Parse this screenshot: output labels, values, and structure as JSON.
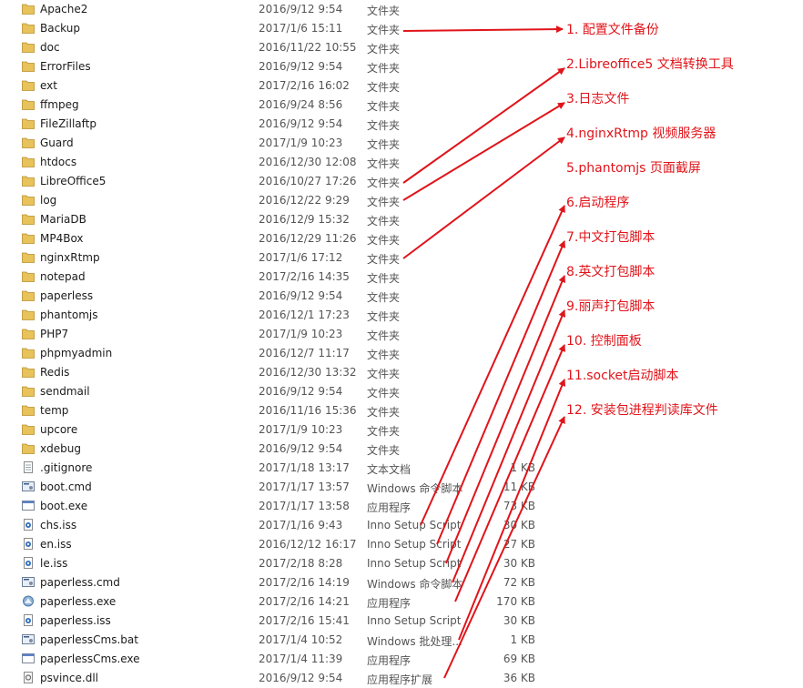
{
  "files": [
    {
      "name": "Apache2",
      "date": "2016/9/12 9:54",
      "type": "文件夹",
      "size": "",
      "kind": "folder"
    },
    {
      "name": "Backup",
      "date": "2017/1/6 15:11",
      "type": "文件夹",
      "size": "",
      "kind": "folder"
    },
    {
      "name": "doc",
      "date": "2016/11/22 10:55",
      "type": "文件夹",
      "size": "",
      "kind": "folder"
    },
    {
      "name": "ErrorFiles",
      "date": "2016/9/12 9:54",
      "type": "文件夹",
      "size": "",
      "kind": "folder"
    },
    {
      "name": "ext",
      "date": "2017/2/16 16:02",
      "type": "文件夹",
      "size": "",
      "kind": "folder"
    },
    {
      "name": "ffmpeg",
      "date": "2016/9/24 8:56",
      "type": "文件夹",
      "size": "",
      "kind": "folder"
    },
    {
      "name": "FileZillaftp",
      "date": "2016/9/12 9:54",
      "type": "文件夹",
      "size": "",
      "kind": "folder"
    },
    {
      "name": "Guard",
      "date": "2017/1/9 10:23",
      "type": "文件夹",
      "size": "",
      "kind": "folder"
    },
    {
      "name": "htdocs",
      "date": "2016/12/30 12:08",
      "type": "文件夹",
      "size": "",
      "kind": "folder"
    },
    {
      "name": "LibreOffice5",
      "date": "2016/10/27 17:26",
      "type": "文件夹",
      "size": "",
      "kind": "folder"
    },
    {
      "name": "log",
      "date": "2016/12/22 9:29",
      "type": "文件夹",
      "size": "",
      "kind": "folder"
    },
    {
      "name": "MariaDB",
      "date": "2016/12/9 15:32",
      "type": "文件夹",
      "size": "",
      "kind": "folder"
    },
    {
      "name": "MP4Box",
      "date": "2016/12/29 11:26",
      "type": "文件夹",
      "size": "",
      "kind": "folder"
    },
    {
      "name": "nginxRtmp",
      "date": "2017/1/6 17:12",
      "type": "文件夹",
      "size": "",
      "kind": "folder"
    },
    {
      "name": "notepad",
      "date": "2017/2/16 14:35",
      "type": "文件夹",
      "size": "",
      "kind": "folder"
    },
    {
      "name": "paperless",
      "date": "2016/9/12 9:54",
      "type": "文件夹",
      "size": "",
      "kind": "folder"
    },
    {
      "name": "phantomjs",
      "date": "2016/12/1 17:23",
      "type": "文件夹",
      "size": "",
      "kind": "folder"
    },
    {
      "name": "PHP7",
      "date": "2017/1/9 10:23",
      "type": "文件夹",
      "size": "",
      "kind": "folder"
    },
    {
      "name": "phpmyadmin",
      "date": "2016/12/7 11:17",
      "type": "文件夹",
      "size": "",
      "kind": "folder"
    },
    {
      "name": "Redis",
      "date": "2016/12/30 13:32",
      "type": "文件夹",
      "size": "",
      "kind": "folder"
    },
    {
      "name": "sendmail",
      "date": "2016/9/12 9:54",
      "type": "文件夹",
      "size": "",
      "kind": "folder"
    },
    {
      "name": "temp",
      "date": "2016/11/16 15:36",
      "type": "文件夹",
      "size": "",
      "kind": "folder"
    },
    {
      "name": "upcore",
      "date": "2017/1/9 10:23",
      "type": "文件夹",
      "size": "",
      "kind": "folder"
    },
    {
      "name": "xdebug",
      "date": "2016/9/12 9:54",
      "type": "文件夹",
      "size": "",
      "kind": "folder"
    },
    {
      "name": ".gitignore",
      "date": "2017/1/18 13:17",
      "type": "文本文档",
      "size": "1 KB",
      "kind": "text"
    },
    {
      "name": "boot.cmd",
      "date": "2017/1/17 13:57",
      "type": "Windows 命令脚本",
      "size": "11 KB",
      "kind": "cmd"
    },
    {
      "name": "boot.exe",
      "date": "2017/1/17 13:58",
      "type": "应用程序",
      "size": "73 KB",
      "kind": "exe"
    },
    {
      "name": "chs.iss",
      "date": "2017/1/16 9:43",
      "type": "Inno Setup Script",
      "size": "30 KB",
      "kind": "iss"
    },
    {
      "name": "en.iss",
      "date": "2016/12/12 16:17",
      "type": "Inno Setup Script",
      "size": "27 KB",
      "kind": "iss"
    },
    {
      "name": "le.iss",
      "date": "2017/2/18 8:28",
      "type": "Inno Setup Script",
      "size": "30 KB",
      "kind": "iss"
    },
    {
      "name": "paperless.cmd",
      "date": "2017/2/16 14:19",
      "type": "Windows 命令脚本",
      "size": "72 KB",
      "kind": "cmd"
    },
    {
      "name": "paperless.exe",
      "date": "2017/2/16 14:21",
      "type": "应用程序",
      "size": "170 KB",
      "kind": "exe-app"
    },
    {
      "name": "paperless.iss",
      "date": "2017/2/16 15:41",
      "type": "Inno Setup Script",
      "size": "30 KB",
      "kind": "iss"
    },
    {
      "name": "paperlessCms.bat",
      "date": "2017/1/4 10:52",
      "type": "Windows 批处理...",
      "size": "1 KB",
      "kind": "cmd"
    },
    {
      "name": "paperlessCms.exe",
      "date": "2017/1/4 11:39",
      "type": "应用程序",
      "size": "69 KB",
      "kind": "exe"
    },
    {
      "name": "psvince.dll",
      "date": "2016/9/12 9:54",
      "type": "应用程序扩展",
      "size": "36 KB",
      "kind": "dll"
    }
  ],
  "annotations": [
    "1. 配置文件备份",
    "2.Libreoffice5 文档转换工具",
    "3.日志文件",
    "4.nginxRtmp 视频服务器",
    "5.phantomjs 页面截屏",
    "6.启动程序",
    "7.中文打包脚本",
    "8.英文打包脚本",
    "9.丽声打包脚本",
    "10. 控制面板",
    "11.socket启动脚本",
    "12. 安装包进程判读库文件"
  ],
  "annotation_color": "#e0141a",
  "folder_color": "#e8c25a"
}
